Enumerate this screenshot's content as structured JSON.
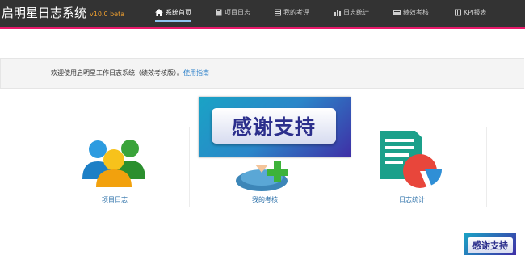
{
  "header": {
    "brand": "启明星日志系统",
    "version": "v10.0 beta",
    "accent_color": "#e8196a",
    "nav": [
      {
        "label": "系统首页",
        "icon": "home-icon",
        "active": true
      },
      {
        "label": "项目日志",
        "icon": "book-icon",
        "active": false
      },
      {
        "label": "我的考评",
        "icon": "grid-icon",
        "active": false
      },
      {
        "label": "日志统计",
        "icon": "bar-chart-icon",
        "active": false
      },
      {
        "label": "绩效考核",
        "icon": "folder-icon",
        "active": false
      },
      {
        "label": "KPI报表",
        "icon": "table-icon",
        "active": false
      }
    ]
  },
  "welcome": {
    "text": "欢迎使用启明星工作日志系统（绩效考核版）。",
    "link": "使用指南"
  },
  "tiles": [
    {
      "label": "项目日志",
      "icon": "users-icon"
    },
    {
      "label": "我的考核",
      "icon": "user-add-icon"
    },
    {
      "label": "日志统计",
      "icon": "report-pie-icon"
    }
  ],
  "popup": {
    "text": "感谢支持",
    "small_text": "感谢支持"
  }
}
